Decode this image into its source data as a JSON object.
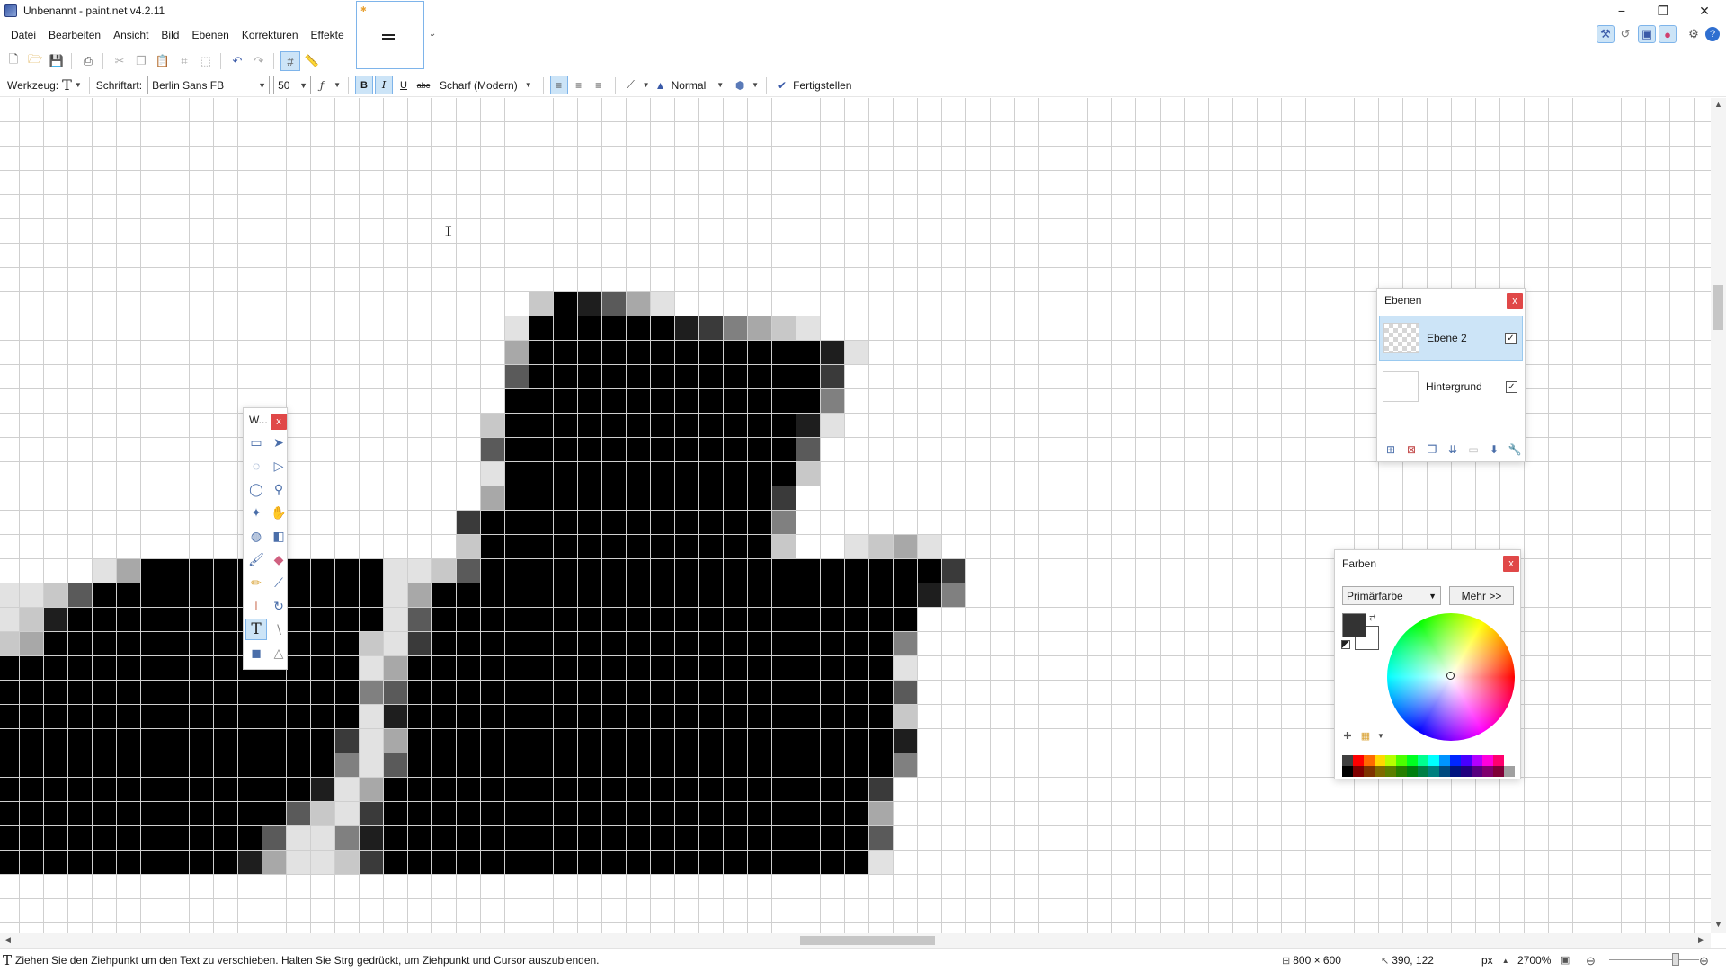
{
  "window": {
    "title": "Unbenannt - paint.net v4.2.11",
    "controls": {
      "minimize": "−",
      "restore": "❐",
      "close": "✕"
    }
  },
  "menu": [
    "Datei",
    "Bearbeiten",
    "Ansicht",
    "Bild",
    "Ebenen",
    "Korrekturen",
    "Effekte"
  ],
  "toolbar": {
    "tool_label": "Werkzeug:",
    "tool_glyph": "T",
    "font_label": "Schriftart:",
    "font_value": "Berlin Sans FB",
    "size_value": "50",
    "bold": "B",
    "italic": "I",
    "underline": "U",
    "strike": "abc",
    "antialias_value": "Scharf (Modern)",
    "blend_value": "Normal",
    "finish_label": "Fertigstellen"
  },
  "tools_window": {
    "title": "W...",
    "close": "x"
  },
  "layers_window": {
    "title": "Ebenen",
    "close": "x",
    "layers": [
      {
        "name": "Ebene 2",
        "checked": true,
        "selected": true
      },
      {
        "name": "Hintergrund",
        "checked": true,
        "selected": false
      }
    ]
  },
  "colors_window": {
    "title": "Farben",
    "close": "x",
    "mode_value": "Primärfarbe",
    "more_label": "Mehr >>",
    "primary_color": "#333333",
    "secondary_color": "#ffffff",
    "palette": [
      "#404040",
      "#ff0000",
      "#ff6a00",
      "#ffd800",
      "#b6ff00",
      "#4cff00",
      "#00ff21",
      "#00ff90",
      "#00ffff",
      "#0094ff",
      "#0026ff",
      "#4800ff",
      "#b200ff",
      "#ff00dc",
      "#ff006e",
      "#ffffff",
      "#000000",
      "#7f0000",
      "#7f3300",
      "#7f6a00",
      "#5b7f00",
      "#267f00",
      "#007f0e",
      "#007f46",
      "#007f7f",
      "#004a7f",
      "#00137f",
      "#21007f",
      "#57007f",
      "#7f006e",
      "#7f0037",
      "#a0a0a0"
    ]
  },
  "status": {
    "text_glyph": "T",
    "message": "Ziehen Sie den Ziehpunkt um den Text zu verschieben. Halten Sie Strg gedrückt, um Ziehpunkt und Cursor auszublenden.",
    "image_size": "800 × 600",
    "cursor_pos": "390, 122",
    "unit": "px",
    "zoom": "2700%"
  },
  "canvas": {
    "pixel_colors": {
      "1": "#000000",
      "2": "#1e1e1e",
      "3": "#3a3a3a",
      "4": "#5a5a5a",
      "5": "#808080",
      "6": "#a8a8a8",
      "7": "#c8c8c8",
      "8": "#e2e2e2"
    }
  }
}
